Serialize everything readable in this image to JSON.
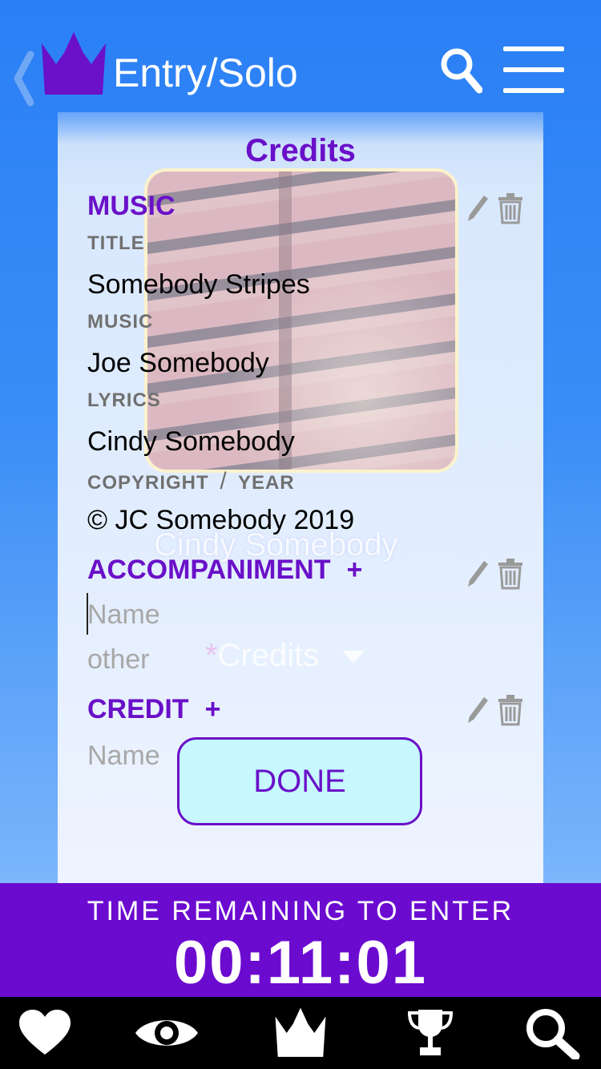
{
  "header": {
    "title": "Entry/Solo"
  },
  "panel": {
    "title": "Credits",
    "music": {
      "heading": "MUSIC",
      "fields": [
        {
          "label": "TITLE",
          "value": "Somebody Stripes"
        },
        {
          "label": "MUSIC",
          "value": "Joe Somebody"
        },
        {
          "label": "LYRICS",
          "value": "Cindy Somebody"
        },
        {
          "label_left": "COPYRIGHT",
          "label_sep": "/",
          "label_right": "YEAR",
          "value": "© JC Somebody 2019"
        }
      ]
    },
    "overlay_name": "Cindy Somebody",
    "accompaniment": {
      "heading": "ACCOMPANIMENT",
      "plus": "+",
      "name_placeholder": "Name",
      "type_placeholder": "other"
    },
    "credits_dropdown": {
      "required_mark": "*",
      "label": "Credits"
    },
    "credit": {
      "heading": "CREDIT",
      "plus": "+",
      "name_placeholder": "Name"
    },
    "done_label": "DONE"
  },
  "timer": {
    "label": "TIME REMAINING TO ENTER",
    "value": "00:11:01"
  },
  "nav": {
    "items": [
      "heart-icon",
      "eye-icon",
      "logo-icon",
      "trophy-icon",
      "search-icon"
    ]
  },
  "colors": {
    "accent_purple": "#6a10c8",
    "header_blue": "#2a7ff5",
    "done_fill": "#c6f8fd"
  }
}
